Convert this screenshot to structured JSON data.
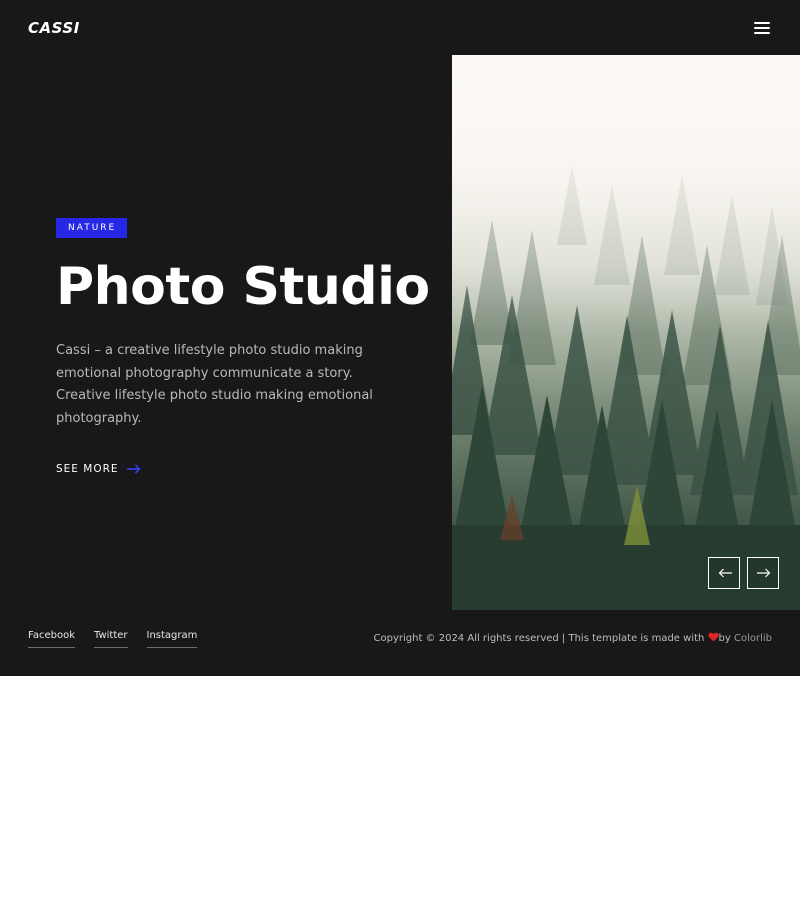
{
  "header": {
    "logo": "CASSI",
    "menu_icon": "hamburger-menu-icon"
  },
  "hero": {
    "badge": "NATURE",
    "title": "Photo Studio",
    "description": "Cassi – a creative lifestyle photo studio making emotional photography communicate a story. Creative lifestyle photo studio making emotional photography.",
    "cta_label": "SEE MORE",
    "cta_icon": "arrow-right-icon"
  },
  "slider": {
    "prev_icon": "arrow-left-icon",
    "next_icon": "arrow-right-icon"
  },
  "footer": {
    "social": [
      "Facebook",
      "Twitter",
      "Instagram"
    ],
    "copyright_prefix": "Copyright © 2024 All rights reserved | This template is made with",
    "heart_icon": "heart-icon",
    "copyright_by": "by",
    "credit_link": "Colorlib"
  },
  "colors": {
    "background": "#181818",
    "accent": "#2628e6",
    "heart": "#e0262b"
  }
}
